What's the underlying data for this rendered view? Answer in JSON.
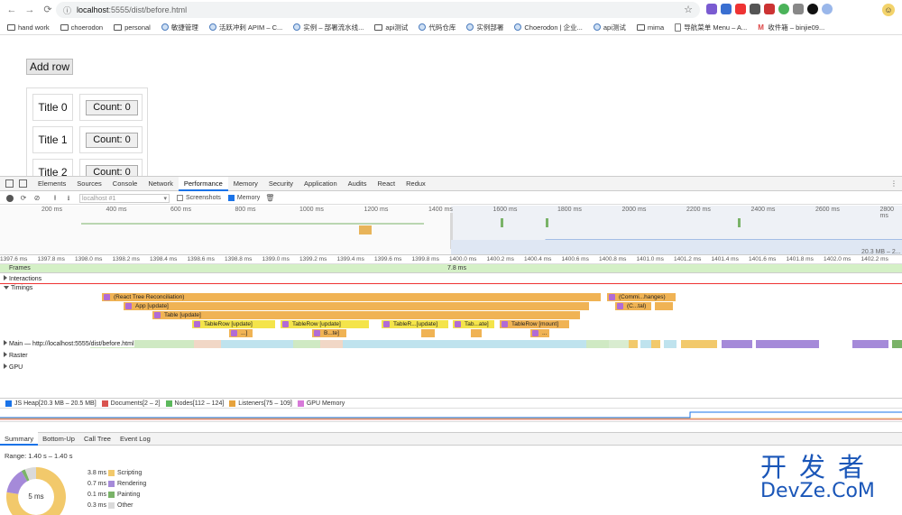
{
  "browser": {
    "url_host": "localhost",
    "url_rest": ":5555/dist/before.html",
    "bookmarks": [
      "hand work",
      "choerodon",
      "personal",
      "敏捷管理",
      "活跃冲刺 APIM – C...",
      "实例 – 部署流水线...",
      "api测试",
      "代码仓库",
      "实例部署",
      "Choerodon | 企业...",
      "api测试",
      "mima",
      "导航菜单 Menu – A...",
      "收件箱 – binjie09..."
    ]
  },
  "page": {
    "add_row_label": "Add row",
    "rows": [
      {
        "title": "Title 0",
        "count": "Count: 0"
      },
      {
        "title": "Title 1",
        "count": "Count: 0"
      },
      {
        "title": "Title 2",
        "count": "Count: 0"
      }
    ]
  },
  "devtools": {
    "tabs": [
      "Elements",
      "Sources",
      "Console",
      "Network",
      "Performance",
      "Memory",
      "Security",
      "Application",
      "Audits",
      "React",
      "Redux"
    ],
    "active_tab": "Performance",
    "toolbar": {
      "profile_placeholder": "localhost #1",
      "screenshots_label": "Screenshots",
      "memory_label": "Memory"
    },
    "overview_ticks": [
      "200 ms",
      "400 ms",
      "600 ms",
      "800 ms",
      "1000 ms",
      "1200 ms",
      "1400 ms",
      "1600 ms",
      "1800 ms",
      "2000 ms",
      "2200 ms",
      "2400 ms",
      "2600 ms",
      "2800 ms"
    ],
    "overview_heap_label": "20.3 MB – 2...",
    "detail_ticks": [
      "1397.6 ms",
      "1397.8 ms",
      "1398.0 ms",
      "1398.2 ms",
      "1398.4 ms",
      "1398.6 ms",
      "1398.8 ms",
      "1399.0 ms",
      "1399.2 ms",
      "1399.4 ms",
      "1399.6 ms",
      "1399.8 ms",
      "1400.0 ms",
      "1400.2 ms",
      "1400.4 ms",
      "1400.6 ms",
      "1400.8 ms",
      "1401.0 ms",
      "1401.2 ms",
      "1401.4 ms",
      "1401.6 ms",
      "1401.8 ms",
      "1402.0 ms",
      "1402.2 ms"
    ],
    "frames": {
      "label": "Frames",
      "duration": "7.8 ms"
    },
    "tracks": {
      "interactions": "Interactions",
      "timings": "Timings",
      "main": "Main — http://localhost:5555/dist/before.html",
      "raster": "Raster",
      "gpu": "GPU"
    },
    "timings": {
      "reconciliation": "(React Tree Reconciliation)",
      "commit": "(Commi...hanges)",
      "app": "App [update]",
      "commit_sub": "(C...tal)",
      "table": "Table [update]",
      "tr1": "TableRow [update]",
      "tr2": "TableRow [update]",
      "tr3": "TableR...[update]",
      "tr4": "Tab...ate]",
      "tr5": "TableRow [mount]",
      "b1": "...]",
      "b2": "B...te]",
      "b3": "..."
    },
    "counters": {
      "js_heap": "JS Heap[20.3 MB – 20.5 MB]",
      "documents": "Documents[2 – 2]",
      "nodes": "Nodes[112 – 124]",
      "listeners": "Listeners[75 – 109]",
      "gpu_memory": "GPU Memory"
    },
    "bottom_tabs": [
      "Summary",
      "Bottom-Up",
      "Call Tree",
      "Event Log"
    ],
    "summary": {
      "range": "Range: 1.40 s – 1.40 s",
      "total": "5 ms",
      "items": [
        {
          "value": "3.8 ms",
          "label": "Scripting",
          "color": "#f2c96b"
        },
        {
          "value": "0.7 ms",
          "label": "Rendering",
          "color": "#a58ad9"
        },
        {
          "value": "0.1 ms",
          "label": "Painting",
          "color": "#7ab368"
        },
        {
          "value": "0.3 ms",
          "label": "Other",
          "color": "#dadada"
        }
      ]
    }
  },
  "watermark": {
    "cn": "开发者",
    "en": "DevZe.CoM"
  },
  "colors": {
    "accent": "#1a73e8",
    "scripting": "#f2c96b",
    "timing_bar": "#f0b354",
    "timing_yellow": "#f4e44a",
    "rendering": "#a58ad9",
    "frames": "#d4f0c6"
  }
}
